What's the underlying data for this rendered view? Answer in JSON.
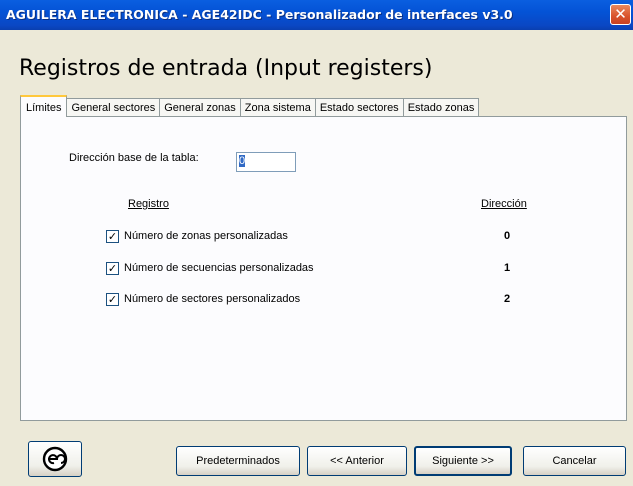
{
  "window": {
    "title": "AGUILERA ELECTRONICA - AGE42IDC - Personalizador de interfaces v3.0",
    "close_icon": "close-icon",
    "titlebar_color": "#0453d6",
    "close_color": "#d9532b"
  },
  "heading": "Registros de entrada (Input registers)",
  "tabs": [
    {
      "label": "Límites",
      "active": true
    },
    {
      "label": "General sectores"
    },
    {
      "label": "General zonas"
    },
    {
      "label": "Zona sistema"
    },
    {
      "label": "Estado sectores"
    },
    {
      "label": "Estado zonas"
    }
  ],
  "form": {
    "base_label": "Dirección base de la tabla:",
    "base_value": "0"
  },
  "table": {
    "col_registro": "Registro",
    "col_direccion": "Dirección",
    "rows": [
      {
        "label": "Número de zonas personalizadas",
        "address": "0",
        "checked": true
      },
      {
        "label": "Número de secuencias personalizadas",
        "address": "1",
        "checked": true
      },
      {
        "label": "Número de sectores personalizados",
        "address": "2",
        "checked": true
      }
    ]
  },
  "buttons": {
    "logo_icon": "ae-logo-icon",
    "defaults": "Predeterminados",
    "previous": "<< Anterior",
    "next": "Siguiente >>",
    "cancel": "Cancelar"
  }
}
